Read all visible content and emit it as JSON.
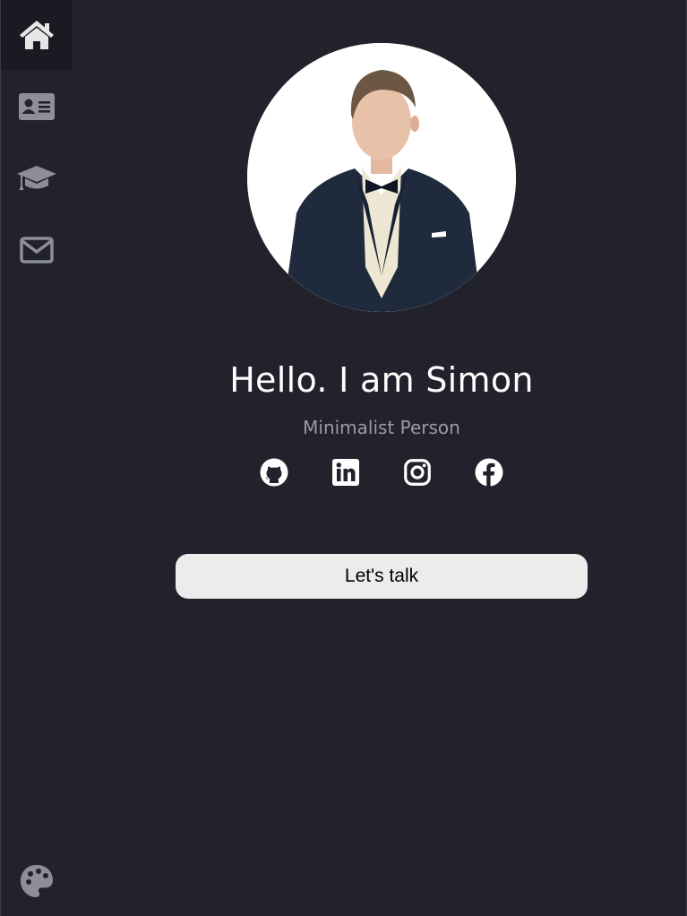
{
  "sidebar": {
    "items": [
      {
        "icon": "home-icon",
        "active": true
      },
      {
        "icon": "id-card-icon",
        "active": false
      },
      {
        "icon": "graduation-cap-icon",
        "active": false
      },
      {
        "icon": "envelope-icon",
        "active": false
      }
    ],
    "footer_icon": "palette-icon"
  },
  "profile": {
    "greeting": "Hello. I am Simon",
    "tagline": "Minimalist Person"
  },
  "social": {
    "icons": [
      "github-icon",
      "linkedin-icon",
      "instagram-icon",
      "facebook-icon"
    ]
  },
  "cta": {
    "label": "Let's talk"
  },
  "colors": {
    "background": "#21222c",
    "active_nav": "#1a1b22",
    "icon_active": "#e6e6e6",
    "icon_inactive": "#8e8f96",
    "button_bg": "#ececec",
    "subtitle": "#9a9ba3"
  }
}
